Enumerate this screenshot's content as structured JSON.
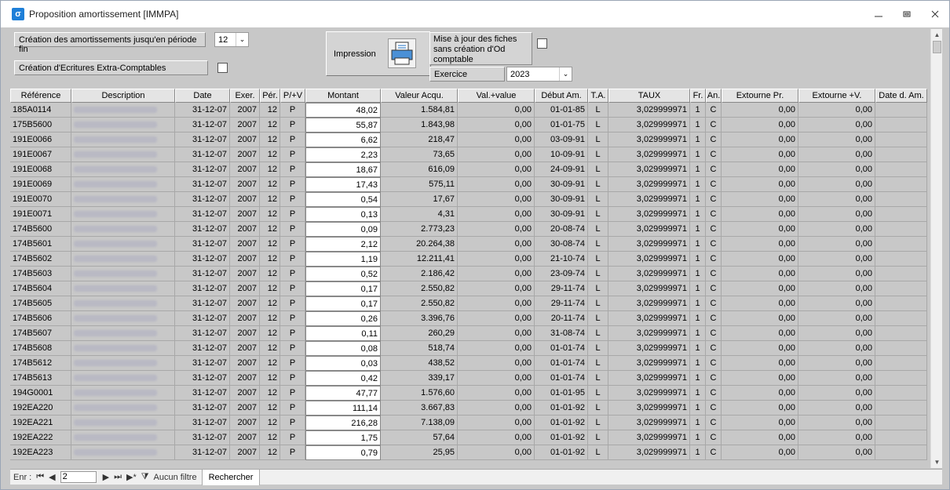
{
  "window": {
    "title": "Proposition amortissement [IMMPA]",
    "icon": "app-icon"
  },
  "form": {
    "periode_label": "Création des amortissements jusqu'en période fin",
    "periode_value": "12",
    "extra_label": "Création d'Ecritures Extra-Comptables",
    "impression_label": "Impression",
    "maj_label": "Mise à jour des fiches sans création d'Od comptable",
    "exercice_label": "Exercice",
    "exercice_value": "2023"
  },
  "columns": [
    "Référence",
    "Description",
    "Date",
    "Exer.",
    "Pér.",
    "P/+V",
    "Montant",
    "Valeur Acqu.",
    "Val.+value",
    "Début Am.",
    "T.A.",
    "TAUX",
    "Fr.",
    "An.",
    "Extourne Pr.",
    "Extourne +V.",
    "Date d. Am."
  ],
  "rows": [
    {
      "ref": "185A0114",
      "date": "31-12-07",
      "exer": "2007",
      "per": "12",
      "pv": "P",
      "montant": "48,02",
      "valeur": "1.584,81",
      "valplus": "0,00",
      "debut": "01-01-85",
      "ta": "L",
      "taux": "3,029999971",
      "fr": "1",
      "an": "C",
      "extpr": "0,00",
      "extv": "0,00"
    },
    {
      "ref": "175B5600",
      "date": "31-12-07",
      "exer": "2007",
      "per": "12",
      "pv": "P",
      "montant": "55,87",
      "valeur": "1.843,98",
      "valplus": "0,00",
      "debut": "01-01-75",
      "ta": "L",
      "taux": "3,029999971",
      "fr": "1",
      "an": "C",
      "extpr": "0,00",
      "extv": "0,00"
    },
    {
      "ref": "191E0066",
      "date": "31-12-07",
      "exer": "2007",
      "per": "12",
      "pv": "P",
      "montant": "6,62",
      "valeur": "218,47",
      "valplus": "0,00",
      "debut": "03-09-91",
      "ta": "L",
      "taux": "3,029999971",
      "fr": "1",
      "an": "C",
      "extpr": "0,00",
      "extv": "0,00"
    },
    {
      "ref": "191E0067",
      "date": "31-12-07",
      "exer": "2007",
      "per": "12",
      "pv": "P",
      "montant": "2,23",
      "valeur": "73,65",
      "valplus": "0,00",
      "debut": "10-09-91",
      "ta": "L",
      "taux": "3,029999971",
      "fr": "1",
      "an": "C",
      "extpr": "0,00",
      "extv": "0,00"
    },
    {
      "ref": "191E0068",
      "date": "31-12-07",
      "exer": "2007",
      "per": "12",
      "pv": "P",
      "montant": "18,67",
      "valeur": "616,09",
      "valplus": "0,00",
      "debut": "24-09-91",
      "ta": "L",
      "taux": "3,029999971",
      "fr": "1",
      "an": "C",
      "extpr": "0,00",
      "extv": "0,00"
    },
    {
      "ref": "191E0069",
      "date": "31-12-07",
      "exer": "2007",
      "per": "12",
      "pv": "P",
      "montant": "17,43",
      "valeur": "575,11",
      "valplus": "0,00",
      "debut": "30-09-91",
      "ta": "L",
      "taux": "3,029999971",
      "fr": "1",
      "an": "C",
      "extpr": "0,00",
      "extv": "0,00"
    },
    {
      "ref": "191E0070",
      "date": "31-12-07",
      "exer": "2007",
      "per": "12",
      "pv": "P",
      "montant": "0,54",
      "valeur": "17,67",
      "valplus": "0,00",
      "debut": "30-09-91",
      "ta": "L",
      "taux": "3,029999971",
      "fr": "1",
      "an": "C",
      "extpr": "0,00",
      "extv": "0,00"
    },
    {
      "ref": "191E0071",
      "date": "31-12-07",
      "exer": "2007",
      "per": "12",
      "pv": "P",
      "montant": "0,13",
      "valeur": "4,31",
      "valplus": "0,00",
      "debut": "30-09-91",
      "ta": "L",
      "taux": "3,029999971",
      "fr": "1",
      "an": "C",
      "extpr": "0,00",
      "extv": "0,00"
    },
    {
      "ref": "174B5600",
      "date": "31-12-07",
      "exer": "2007",
      "per": "12",
      "pv": "P",
      "montant": "0,09",
      "valeur": "2.773,23",
      "valplus": "0,00",
      "debut": "20-08-74",
      "ta": "L",
      "taux": "3,029999971",
      "fr": "1",
      "an": "C",
      "extpr": "0,00",
      "extv": "0,00"
    },
    {
      "ref": "174B5601",
      "date": "31-12-07",
      "exer": "2007",
      "per": "12",
      "pv": "P",
      "montant": "2,12",
      "valeur": "20.264,38",
      "valplus": "0,00",
      "debut": "30-08-74",
      "ta": "L",
      "taux": "3,029999971",
      "fr": "1",
      "an": "C",
      "extpr": "0,00",
      "extv": "0,00"
    },
    {
      "ref": "174B5602",
      "date": "31-12-07",
      "exer": "2007",
      "per": "12",
      "pv": "P",
      "montant": "1,19",
      "valeur": "12.211,41",
      "valplus": "0,00",
      "debut": "21-10-74",
      "ta": "L",
      "taux": "3,029999971",
      "fr": "1",
      "an": "C",
      "extpr": "0,00",
      "extv": "0,00"
    },
    {
      "ref": "174B5603",
      "date": "31-12-07",
      "exer": "2007",
      "per": "12",
      "pv": "P",
      "montant": "0,52",
      "valeur": "2.186,42",
      "valplus": "0,00",
      "debut": "23-09-74",
      "ta": "L",
      "taux": "3,029999971",
      "fr": "1",
      "an": "C",
      "extpr": "0,00",
      "extv": "0,00"
    },
    {
      "ref": "174B5604",
      "date": "31-12-07",
      "exer": "2007",
      "per": "12",
      "pv": "P",
      "montant": "0,17",
      "valeur": "2.550,82",
      "valplus": "0,00",
      "debut": "29-11-74",
      "ta": "L",
      "taux": "3,029999971",
      "fr": "1",
      "an": "C",
      "extpr": "0,00",
      "extv": "0,00"
    },
    {
      "ref": "174B5605",
      "date": "31-12-07",
      "exer": "2007",
      "per": "12",
      "pv": "P",
      "montant": "0,17",
      "valeur": "2.550,82",
      "valplus": "0,00",
      "debut": "29-11-74",
      "ta": "L",
      "taux": "3,029999971",
      "fr": "1",
      "an": "C",
      "extpr": "0,00",
      "extv": "0,00"
    },
    {
      "ref": "174B5606",
      "date": "31-12-07",
      "exer": "2007",
      "per": "12",
      "pv": "P",
      "montant": "0,26",
      "valeur": "3.396,76",
      "valplus": "0,00",
      "debut": "20-11-74",
      "ta": "L",
      "taux": "3,029999971",
      "fr": "1",
      "an": "C",
      "extpr": "0,00",
      "extv": "0,00"
    },
    {
      "ref": "174B5607",
      "date": "31-12-07",
      "exer": "2007",
      "per": "12",
      "pv": "P",
      "montant": "0,11",
      "valeur": "260,29",
      "valplus": "0,00",
      "debut": "31-08-74",
      "ta": "L",
      "taux": "3,029999971",
      "fr": "1",
      "an": "C",
      "extpr": "0,00",
      "extv": "0,00"
    },
    {
      "ref": "174B5608",
      "date": "31-12-07",
      "exer": "2007",
      "per": "12",
      "pv": "P",
      "montant": "0,08",
      "valeur": "518,74",
      "valplus": "0,00",
      "debut": "01-01-74",
      "ta": "L",
      "taux": "3,029999971",
      "fr": "1",
      "an": "C",
      "extpr": "0,00",
      "extv": "0,00"
    },
    {
      "ref": "174B5612",
      "date": "31-12-07",
      "exer": "2007",
      "per": "12",
      "pv": "P",
      "montant": "0,03",
      "valeur": "438,52",
      "valplus": "0,00",
      "debut": "01-01-74",
      "ta": "L",
      "taux": "3,029999971",
      "fr": "1",
      "an": "C",
      "extpr": "0,00",
      "extv": "0,00"
    },
    {
      "ref": "174B5613",
      "date": "31-12-07",
      "exer": "2007",
      "per": "12",
      "pv": "P",
      "montant": "0,42",
      "valeur": "339,17",
      "valplus": "0,00",
      "debut": "01-01-74",
      "ta": "L",
      "taux": "3,029999971",
      "fr": "1",
      "an": "C",
      "extpr": "0,00",
      "extv": "0,00"
    },
    {
      "ref": "194G0001",
      "date": "31-12-07",
      "exer": "2007",
      "per": "12",
      "pv": "P",
      "montant": "47,77",
      "valeur": "1.576,60",
      "valplus": "0,00",
      "debut": "01-01-95",
      "ta": "L",
      "taux": "3,029999971",
      "fr": "1",
      "an": "C",
      "extpr": "0,00",
      "extv": "0,00"
    },
    {
      "ref": "192EA220",
      "date": "31-12-07",
      "exer": "2007",
      "per": "12",
      "pv": "P",
      "montant": "111,14",
      "valeur": "3.667,83",
      "valplus": "0,00",
      "debut": "01-01-92",
      "ta": "L",
      "taux": "3,029999971",
      "fr": "1",
      "an": "C",
      "extpr": "0,00",
      "extv": "0,00"
    },
    {
      "ref": "192EA221",
      "date": "31-12-07",
      "exer": "2007",
      "per": "12",
      "pv": "P",
      "montant": "216,28",
      "valeur": "7.138,09",
      "valplus": "0,00",
      "debut": "01-01-92",
      "ta": "L",
      "taux": "3,029999971",
      "fr": "1",
      "an": "C",
      "extpr": "0,00",
      "extv": "0,00"
    },
    {
      "ref": "192EA222",
      "date": "31-12-07",
      "exer": "2007",
      "per": "12",
      "pv": "P",
      "montant": "1,75",
      "valeur": "57,64",
      "valplus": "0,00",
      "debut": "01-01-92",
      "ta": "L",
      "taux": "3,029999971",
      "fr": "1",
      "an": "C",
      "extpr": "0,00",
      "extv": "0,00"
    },
    {
      "ref": "192EA223",
      "date": "31-12-07",
      "exer": "2007",
      "per": "12",
      "pv": "P",
      "montant": "0,79",
      "valeur": "25,95",
      "valplus": "0,00",
      "debut": "01-01-92",
      "ta": "L",
      "taux": "3,029999971",
      "fr": "1",
      "an": "C",
      "extpr": "0,00",
      "extv": "0,00"
    }
  ],
  "status": {
    "enr_label": "Enr :",
    "record": "2",
    "filter_label": "Aucun filtre",
    "search_label": "Rechercher"
  }
}
